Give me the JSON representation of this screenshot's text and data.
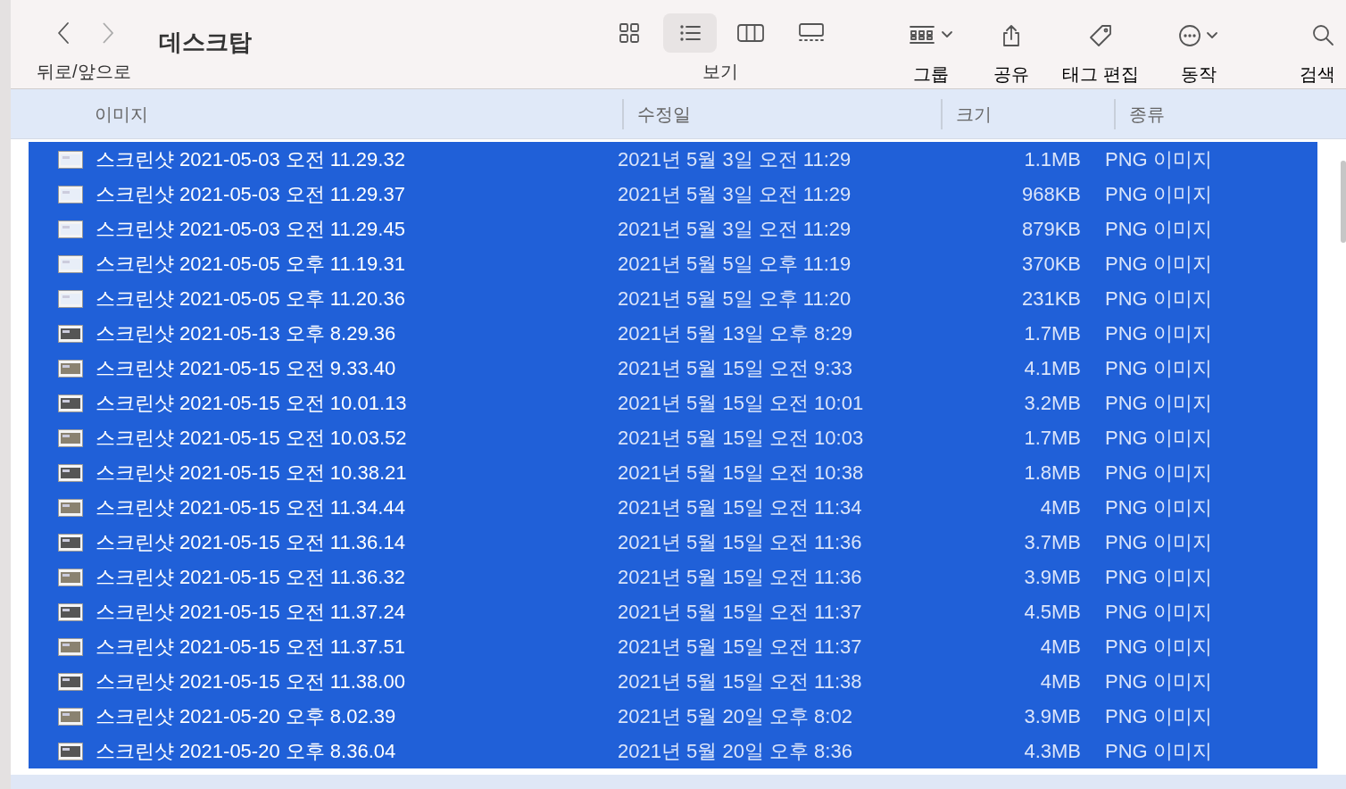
{
  "toolbar": {
    "nav_label": "뒤로/앞으로",
    "title": "데스크탑",
    "view_label": "보기",
    "views": [
      {
        "kind": "icons",
        "selected": false
      },
      {
        "kind": "list",
        "selected": true
      },
      {
        "kind": "columns",
        "selected": false
      },
      {
        "kind": "gallery",
        "selected": false
      }
    ],
    "actions": [
      {
        "kind": "group",
        "label": "그룹"
      },
      {
        "kind": "share",
        "label": "공유"
      },
      {
        "kind": "tag",
        "label": "태그 편집"
      },
      {
        "kind": "action",
        "label": "동작"
      },
      {
        "kind": "search",
        "label": "검색"
      }
    ]
  },
  "table": {
    "columns": [
      "이미지",
      "수정일",
      "크기",
      "종류"
    ],
    "rows": [
      {
        "name": "스크린샷 2021-05-03 오전 11.29.32",
        "date": "2021년 5월 3일 오전 11:29",
        "size": "1.1MB",
        "kind": "PNG 이미지",
        "selected": true
      },
      {
        "name": "스크린샷 2021-05-03 오전 11.29.37",
        "date": "2021년 5월 3일 오전 11:29",
        "size": "968KB",
        "kind": "PNG 이미지",
        "selected": true
      },
      {
        "name": "스크린샷 2021-05-03 오전 11.29.45",
        "date": "2021년 5월 3일 오전 11:29",
        "size": "879KB",
        "kind": "PNG 이미지",
        "selected": true
      },
      {
        "name": "스크린샷 2021-05-05 오후 11.19.31",
        "date": "2021년 5월 5일 오후 11:19",
        "size": "370KB",
        "kind": "PNG 이미지",
        "selected": true
      },
      {
        "name": "스크린샷 2021-05-05 오후 11.20.36",
        "date": "2021년 5월 5일 오후 11:20",
        "size": "231KB",
        "kind": "PNG 이미지",
        "selected": true
      },
      {
        "name": "스크린샷 2021-05-13 오후 8.29.36",
        "date": "2021년 5월 13일 오후 8:29",
        "size": "1.7MB",
        "kind": "PNG 이미지",
        "selected": true
      },
      {
        "name": "스크린샷 2021-05-15 오전 9.33.40",
        "date": "2021년 5월 15일 오전 9:33",
        "size": "4.1MB",
        "kind": "PNG 이미지",
        "selected": true
      },
      {
        "name": "스크린샷 2021-05-15 오전 10.01.13",
        "date": "2021년 5월 15일 오전 10:01",
        "size": "3.2MB",
        "kind": "PNG 이미지",
        "selected": true
      },
      {
        "name": "스크린샷 2021-05-15 오전 10.03.52",
        "date": "2021년 5월 15일 오전 10:03",
        "size": "1.7MB",
        "kind": "PNG 이미지",
        "selected": true
      },
      {
        "name": "스크린샷 2021-05-15 오전 10.38.21",
        "date": "2021년 5월 15일 오전 10:38",
        "size": "1.8MB",
        "kind": "PNG 이미지",
        "selected": true
      },
      {
        "name": "스크린샷 2021-05-15 오전 11.34.44",
        "date": "2021년 5월 15일 오전 11:34",
        "size": "4MB",
        "kind": "PNG 이미지",
        "selected": true
      },
      {
        "name": "스크린샷 2021-05-15 오전 11.36.14",
        "date": "2021년 5월 15일 오전 11:36",
        "size": "3.7MB",
        "kind": "PNG 이미지",
        "selected": true
      },
      {
        "name": "스크린샷 2021-05-15 오전 11.36.32",
        "date": "2021년 5월 15일 오전 11:36",
        "size": "3.9MB",
        "kind": "PNG 이미지",
        "selected": true
      },
      {
        "name": "스크린샷 2021-05-15 오전 11.37.24",
        "date": "2021년 5월 15일 오전 11:37",
        "size": "4.5MB",
        "kind": "PNG 이미지",
        "selected": true
      },
      {
        "name": "스크린샷 2021-05-15 오전 11.37.51",
        "date": "2021년 5월 15일 오전 11:37",
        "size": "4MB",
        "kind": "PNG 이미지",
        "selected": true
      },
      {
        "name": "스크린샷 2021-05-15 오전 11.38.00",
        "date": "2021년 5월 15일 오전 11:38",
        "size": "4MB",
        "kind": "PNG 이미지",
        "selected": true
      },
      {
        "name": "스크린샷 2021-05-20 오후 8.02.39",
        "date": "2021년 5월 20일 오후 8:02",
        "size": "3.9MB",
        "kind": "PNG 이미지",
        "selected": true
      },
      {
        "name": "스크린샷 2021-05-20 오후 8.36.04",
        "date": "2021년 5월 20일 오후 8:36",
        "size": "4.3MB",
        "kind": "PNG 이미지",
        "selected": true
      }
    ]
  }
}
